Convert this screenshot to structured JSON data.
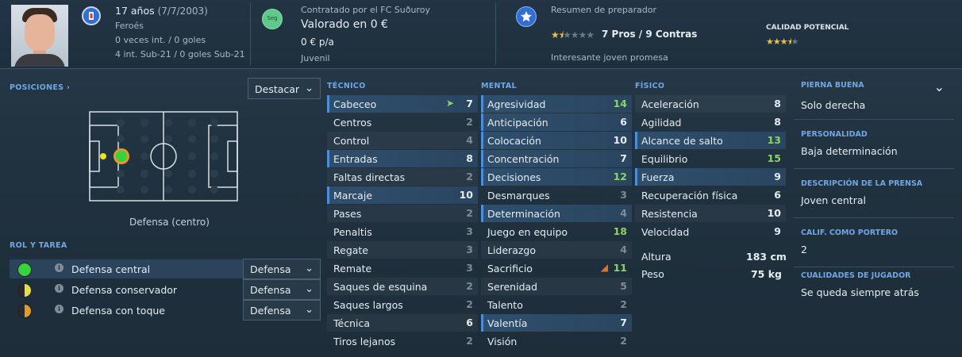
{
  "header": {
    "age_text": "17 años",
    "dob_text": "(7/7/2003)",
    "nationality": "Feroés",
    "caps_text": "0 veces int. / 0 goles",
    "u21_text": "4 int. Sub-21 / 0 goles Sub-21",
    "contract_label": "Contratado por el FC Suðuroy",
    "contract_badge": "Seg",
    "valued_text": "Valorado en 0 €",
    "wage_text": "0 € p/a",
    "contract_type": "Juvenil",
    "coach_summary_label": "Resumen de preparador",
    "current_stars": 1.5,
    "pros_cons": "7 Pros / 9 Contras",
    "coach_comment": "Interesante joven promesa",
    "potential_label": "CALIDAD POTENCIAL",
    "potential_stars": 3.5
  },
  "positions": {
    "title": "POSICIONES",
    "highlight_label": "Destacar",
    "position_name": "Defensa (centro)"
  },
  "roles": {
    "title": "ROL Y TAREA",
    "items": [
      {
        "name": "Defensa central",
        "duty": "Defensa",
        "rating": "full"
      },
      {
        "name": "Defensa conservador",
        "duty": "Defensa",
        "rating": "half"
      },
      {
        "name": "Defensa con toque",
        "duty": "Defensa",
        "rating": "half-orange"
      }
    ]
  },
  "technical": {
    "title": "TÉCNICO",
    "items": [
      {
        "name": "Cabeceo",
        "value": "7",
        "hl": true,
        "arrow": "up"
      },
      {
        "name": "Centros",
        "value": "2"
      },
      {
        "name": "Control",
        "value": "4"
      },
      {
        "name": "Entradas",
        "value": "8",
        "hl": true
      },
      {
        "name": "Faltas directas",
        "value": "2"
      },
      {
        "name": "Marcaje",
        "value": "10",
        "hl": true
      },
      {
        "name": "Pases",
        "value": "2"
      },
      {
        "name": "Penaltis",
        "value": "3"
      },
      {
        "name": "Regate",
        "value": "3"
      },
      {
        "name": "Remate",
        "value": "3"
      },
      {
        "name": "Saques de esquina",
        "value": "2"
      },
      {
        "name": "Saques largos",
        "value": "2"
      },
      {
        "name": "Técnica",
        "value": "6"
      },
      {
        "name": "Tiros lejanos",
        "value": "2"
      }
    ]
  },
  "mental": {
    "title": "MENTAL",
    "items": [
      {
        "name": "Agresividad",
        "value": "14",
        "hl": true
      },
      {
        "name": "Anticipación",
        "value": "6",
        "hl": true
      },
      {
        "name": "Colocación",
        "value": "10",
        "hl": true
      },
      {
        "name": "Concentración",
        "value": "7",
        "hl": true
      },
      {
        "name": "Decisiones",
        "value": "12",
        "hl": true
      },
      {
        "name": "Desmarques",
        "value": "3"
      },
      {
        "name": "Determinación",
        "value": "4",
        "hl": true
      },
      {
        "name": "Juego en equipo",
        "value": "18"
      },
      {
        "name": "Liderazgo",
        "value": "4"
      },
      {
        "name": "Sacrificio",
        "value": "11",
        "arrow": "down"
      },
      {
        "name": "Serenidad",
        "value": "5"
      },
      {
        "name": "Talento",
        "value": "2"
      },
      {
        "name": "Valentía",
        "value": "7",
        "hl": true
      },
      {
        "name": "Visión",
        "value": "2"
      }
    ]
  },
  "physical": {
    "title": "FÍSICO",
    "items": [
      {
        "name": "Aceleración",
        "value": "8"
      },
      {
        "name": "Agilidad",
        "value": "8"
      },
      {
        "name": "Alcance de salto",
        "value": "13",
        "hl": true
      },
      {
        "name": "Equilibrio",
        "value": "15"
      },
      {
        "name": "Fuerza",
        "value": "9",
        "hl": true
      },
      {
        "name": "Recuperación física",
        "value": "6"
      },
      {
        "name": "Resistencia",
        "value": "10"
      },
      {
        "name": "Velocidad",
        "value": "9"
      }
    ],
    "height_label": "Altura",
    "height_value": "183 cm",
    "weight_label": "Peso",
    "weight_value": "75 kg"
  },
  "info": {
    "items": [
      {
        "title": "PIERNA BUENA",
        "value": "Solo derecha"
      },
      {
        "title": "PERSONALIDAD",
        "value": "Baja determinación"
      },
      {
        "title": "DESCRIPCIÓN DE LA PRENSA",
        "value": "Joven central"
      },
      {
        "title": "CALIF. COMO PORTERO",
        "value": "2"
      },
      {
        "title": "CUALIDADES DE JUGADOR",
        "value": "Se queda siempre atrás"
      }
    ]
  },
  "colors": {
    "accent": "#6fa6e6",
    "good": "#8ed36a",
    "highlight_row": "#2f4f6c"
  }
}
